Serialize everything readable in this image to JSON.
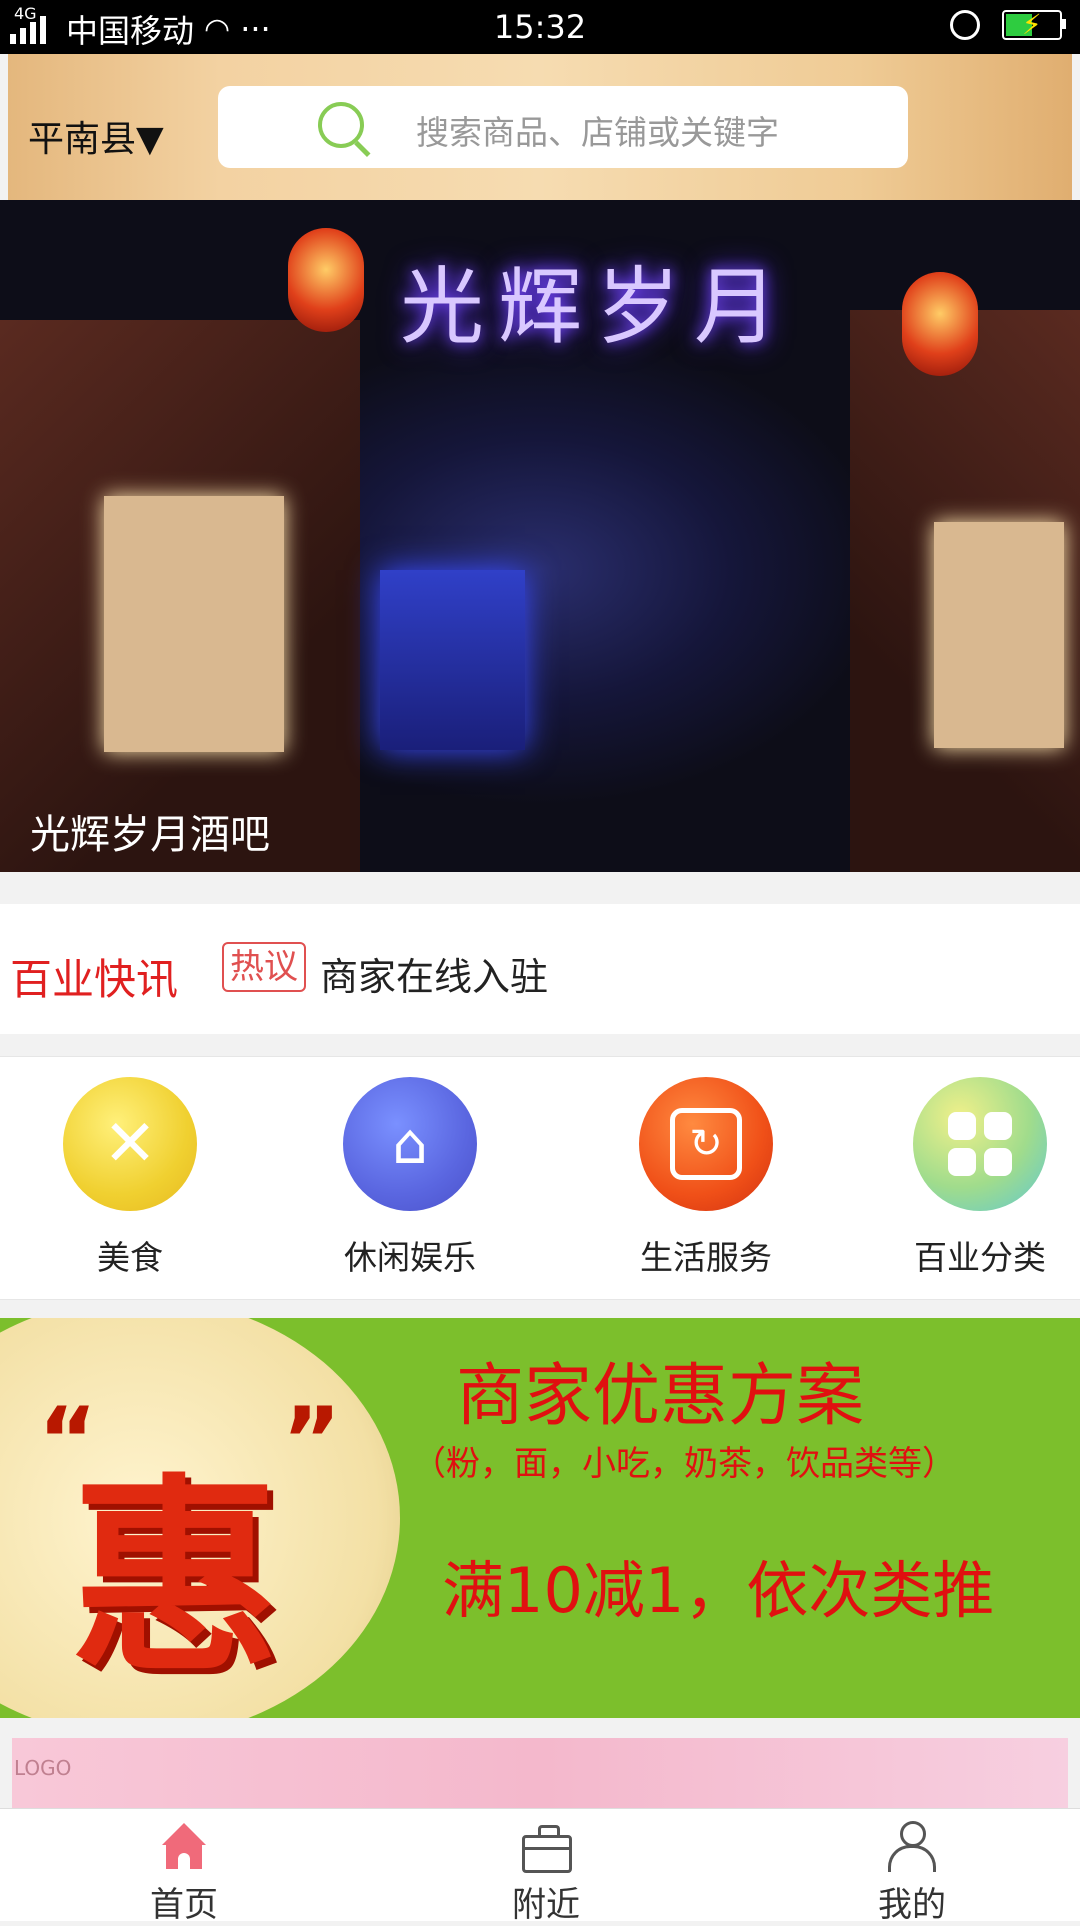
{
  "status_bar": {
    "network": "4G",
    "carrier": "中国移动",
    "more": "···",
    "time": "15:32"
  },
  "header": {
    "location": "平南县▼",
    "search_placeholder": "搜索商品、店铺或关键字"
  },
  "banner": {
    "sign_text": "光辉岁月",
    "caption": "光辉岁月酒吧"
  },
  "news": {
    "title": "百业快讯",
    "tag": "热议",
    "text": "商家在线入驻"
  },
  "categories": [
    {
      "label": "美食",
      "icon": "fork-knife-icon",
      "color": "#f0d030"
    },
    {
      "label": "休闲娱乐",
      "icon": "palm-island-icon",
      "color": "#5a66e0"
    },
    {
      "label": "生活服务",
      "icon": "refresh-icon",
      "color": "#f05018"
    },
    {
      "label": "百业分类",
      "icon": "grid-icon",
      "color": "#a0dc8c"
    }
  ],
  "promo": {
    "hui": "惠",
    "title": "商家优惠方案",
    "subtitle": "（粉，面，小吃，奶茶，饮品类等）",
    "offer": "满10减1，依次类推"
  },
  "strip": {
    "logo": "LOGO"
  },
  "tabbar": [
    {
      "label": "首页",
      "icon": "home-icon",
      "active": true
    },
    {
      "label": "附近",
      "icon": "briefcase-icon",
      "active": false
    },
    {
      "label": "我的",
      "icon": "person-icon",
      "active": false
    }
  ]
}
